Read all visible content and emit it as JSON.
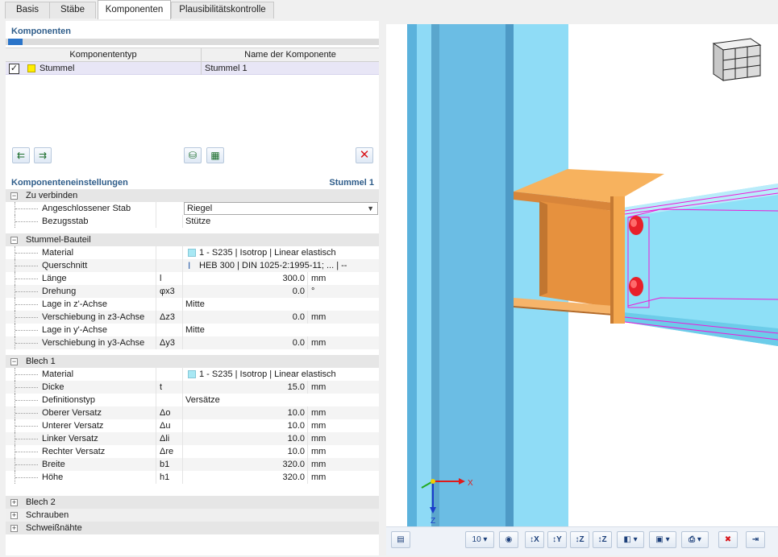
{
  "tabs": [
    {
      "label": "Basis"
    },
    {
      "label": "Stäbe"
    },
    {
      "label": "Komponenten"
    },
    {
      "label": "Plausibilitätskontrolle"
    }
  ],
  "components": {
    "title": "Komponenten",
    "col_type": "Komponententyp",
    "col_name": "Name der Komponente",
    "rows": [
      {
        "checked": "✓",
        "type": "Stummel",
        "name": "Stummel 1",
        "color": "#ffee00"
      }
    ]
  },
  "settings": {
    "title": "Komponenteneinstellungen",
    "current": "Stummel 1",
    "groups": [
      {
        "label": "Zu verbinden",
        "pm": "−",
        "rows": [
          {
            "label": "Angeschlossener Stab",
            "sym": "",
            "value": "Riegel",
            "unit": ""
          },
          {
            "label": "Bezugsstab",
            "sym": "",
            "value": "Stütze",
            "unit": ""
          }
        ]
      },
      {
        "label": "Stummel-Bauteil",
        "pm": "−",
        "rows": [
          {
            "label": "Material",
            "sym": "",
            "value": "1 - S235 | Isotrop | Linear elastisch",
            "unit": ""
          },
          {
            "label": "Querschnitt",
            "sym": "",
            "value": "HEB 300 | DIN 1025-2:1995-11; ... | --",
            "unit": ""
          },
          {
            "label": "Länge",
            "sym": "l",
            "value": "300.0",
            "unit": "mm"
          },
          {
            "label": "Drehung",
            "sym": "φx3",
            "value": "0.0",
            "unit": "°"
          },
          {
            "label": "Lage in z'-Achse",
            "sym": "",
            "value": "Mitte",
            "unit": ""
          },
          {
            "label": "Verschiebung in z3-Achse",
            "sym": "Δz3",
            "value": "0.0",
            "unit": "mm"
          },
          {
            "label": "Lage in y'-Achse",
            "sym": "",
            "value": "Mitte",
            "unit": ""
          },
          {
            "label": "Verschiebung in y3-Achse",
            "sym": "Δy3",
            "value": "0.0",
            "unit": "mm"
          }
        ]
      },
      {
        "label": "Blech 1",
        "pm": "−",
        "rows": [
          {
            "label": "Material",
            "sym": "",
            "value": "1 - S235 | Isotrop | Linear elastisch",
            "unit": ""
          },
          {
            "label": "Dicke",
            "sym": "t",
            "value": "15.0",
            "unit": "mm"
          },
          {
            "label": "Definitionstyp",
            "sym": "",
            "value": "Versätze",
            "unit": ""
          },
          {
            "label": "Oberer Versatz",
            "sym": "Δo",
            "value": "10.0",
            "unit": "mm"
          },
          {
            "label": "Unterer Versatz",
            "sym": "Δu",
            "value": "10.0",
            "unit": "mm"
          },
          {
            "label": "Linker Versatz",
            "sym": "Δli",
            "value": "10.0",
            "unit": "mm"
          },
          {
            "label": "Rechter Versatz",
            "sym": "Δre",
            "value": "10.0",
            "unit": "mm"
          },
          {
            "label": "Breite",
            "sym": "b1",
            "value": "320.0",
            "unit": "mm"
          },
          {
            "label": "Höhe",
            "sym": "h1",
            "value": "320.0",
            "unit": "mm"
          }
        ]
      }
    ],
    "collapsed": [
      {
        "label": "Blech 2",
        "pm": "+"
      },
      {
        "label": "Schrauben",
        "pm": "+"
      },
      {
        "label": "Schweißnähte",
        "pm": "+"
      }
    ]
  },
  "viewport": {
    "axis_x": "X",
    "axis_z": "Z",
    "zoom_value": "10",
    "colors": {
      "column": "#74ccf0",
      "column_dark": "#5aa6cd",
      "beam": "#8fe0f6",
      "stub": "#f2a04c",
      "bolt": "#e8202a",
      "weld": "#ee1ad8"
    }
  },
  "viewbar": {
    "btn_x": "↕X",
    "btn_y": "↕Y",
    "btn_z": "↕Z",
    "btn_iso": "↕Z"
  }
}
